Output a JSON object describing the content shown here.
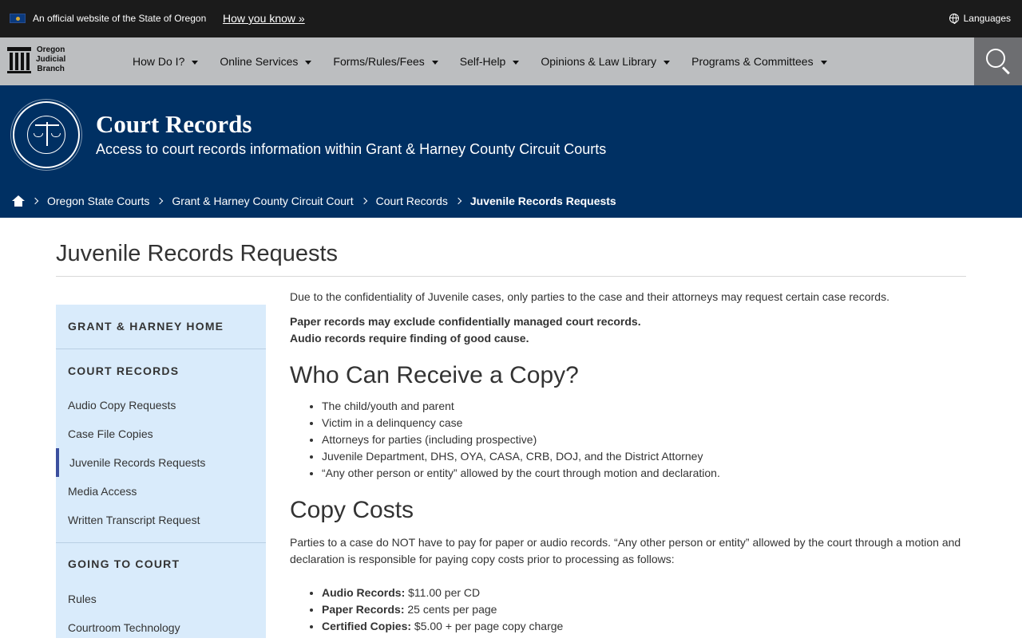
{
  "official_bar": {
    "text": "An official website of the State of Oregon",
    "how_link": "How you know »",
    "languages": "Languages"
  },
  "logo": {
    "line1": "Oregon",
    "line2": "Judicial",
    "line3": "Branch"
  },
  "nav": {
    "items": [
      {
        "label": "How Do I?"
      },
      {
        "label": "Online Services"
      },
      {
        "label": "Forms/Rules/Fees"
      },
      {
        "label": "Self-Help"
      },
      {
        "label": "Opinions & Law Library"
      },
      {
        "label": "Programs & Committees"
      }
    ]
  },
  "hero": {
    "title": "Court Records",
    "subtitle": "Access to court records information within Grant & Harney County Circuit Courts"
  },
  "breadcrumb": {
    "items": [
      {
        "label": "Oregon State Courts"
      },
      {
        "label": "Grant & Harney County Circuit Court"
      },
      {
        "label": "Court Records"
      }
    ],
    "current": "Juvenile Records Requests"
  },
  "page": {
    "title": "Juvenile Records Requests"
  },
  "sidebar": {
    "home": "GRANT & HARNEY HOME",
    "court_records_head": "COURT RECORDS",
    "court_records_links": [
      {
        "label": "Audio Copy Requests"
      },
      {
        "label": "Case File Copies"
      },
      {
        "label": "Juvenile Records Requests"
      },
      {
        "label": "Media Access"
      },
      {
        "label": "Written Transcript Request"
      }
    ],
    "going_to_court_head": "GOING TO COURT",
    "going_to_court_links": [
      {
        "label": "Rules"
      },
      {
        "label": "Courtroom Technology"
      }
    ]
  },
  "content": {
    "intro": "Due to the confidentiality of Juvenile cases, only parties to the case and their attorneys may request certain case records.",
    "note1": "Paper records may exclude confidentially managed court records.",
    "note2": "Audio records require finding of good cause.",
    "who_heading": "Who Can Receive a Copy?",
    "who_list": [
      "The child/youth and parent",
      "Victim in a delinquency case",
      "Attorneys for parties (including prospective)",
      "Juvenile Department, DHS, OYA, CASA, CRB, DOJ, and the District Attorney",
      "“Any other person or entity” allowed by the court through motion and declaration."
    ],
    "costs_heading": "Copy Costs",
    "costs_para": "Parties to a case do NOT have to pay for paper or audio records. “Any other person or entity” allowed by the court through a motion and declaration is responsible for paying copy costs prior to processing as follows:",
    "costs_list": [
      {
        "label": "Audio Records:",
        "value": " $11.00 per CD"
      },
      {
        "label": "Paper Records:",
        "value": " 25 cents per page"
      },
      {
        "label": "Certified Copies:",
        "value": " $5.00 + per page copy charge"
      }
    ]
  }
}
